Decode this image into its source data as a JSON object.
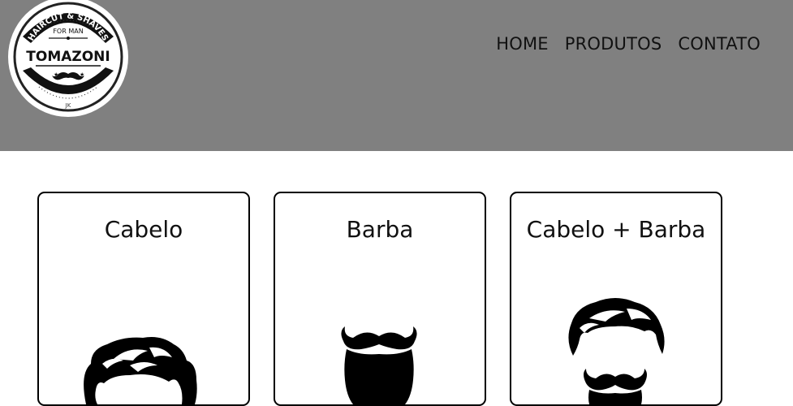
{
  "logo": {
    "arc_top_text": "HAIRCUT & SHAVES",
    "sub_text": "FOR MAN",
    "brand": "TOMAZONI",
    "bottom_mark": "JK"
  },
  "nav": {
    "items": [
      {
        "label": "HOME"
      },
      {
        "label": "PRODUTOS"
      },
      {
        "label": "CONTATO"
      }
    ]
  },
  "cards": [
    {
      "title": "Cabelo",
      "icon": "hair-icon"
    },
    {
      "title": "Barba",
      "icon": "beard-icon"
    },
    {
      "title": "Cabelo + Barba",
      "icon": "hair-beard-icon"
    }
  ],
  "colors": {
    "header_bg": "#808080",
    "card_border": "#000000",
    "text": "#111111"
  }
}
